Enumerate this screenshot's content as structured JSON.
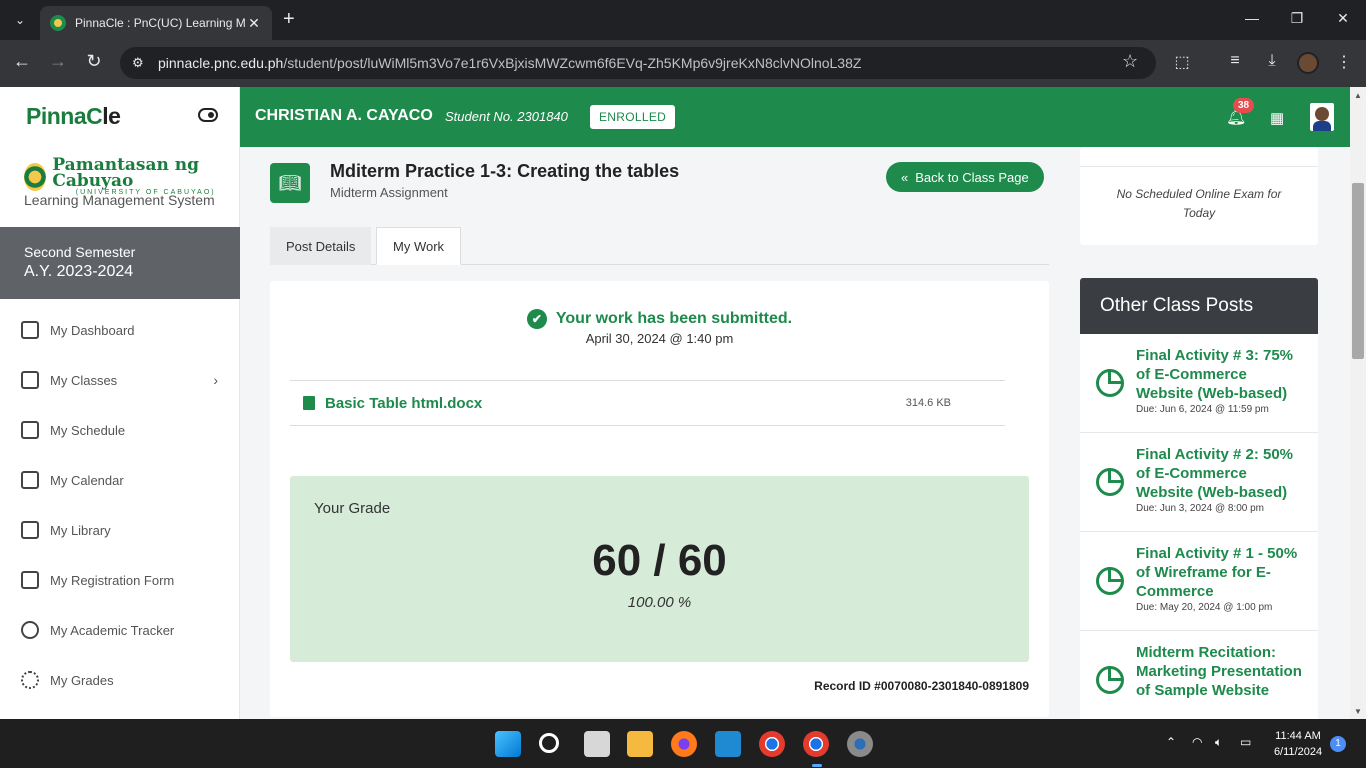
{
  "browser": {
    "tab_title": "PinnaCle : PnC(UC) Learning Ma",
    "url_host": "pinnacle.pnc.edu.ph",
    "url_path": "/student/post/luWiMl5m3Vo7e1r6VxBjxisMWZcwm6f6EVq-Zh5KMp6v9jreKxN8clvNOlnoL38Z"
  },
  "sidebar": {
    "logo_pin": "PinnaC",
    "logo_le": "le",
    "university_name": "Pamantasan ng Cabuyao",
    "university_sub": "(UNIVERSITY OF CABUYAO)",
    "system": "Learning Management System",
    "semester": "Second Semester",
    "academic_year": "A.Y. 2023-2024",
    "items": [
      {
        "label": "My Dashboard"
      },
      {
        "label": "My Classes"
      },
      {
        "label": "My Schedule"
      },
      {
        "label": "My Calendar"
      },
      {
        "label": "My Library"
      },
      {
        "label": "My Registration Form"
      },
      {
        "label": "My Academic Tracker"
      },
      {
        "label": "My Grades"
      }
    ]
  },
  "header": {
    "student_name": "CHRISTIAN A. CAYACO",
    "student_no": "Student No. 2301840",
    "status": "ENROLLED",
    "notifications": "38"
  },
  "post": {
    "title": "Mditerm Practice 1-3: Creating the tables",
    "subtitle": "Midterm Assignment",
    "back_label": "Back to Class Page",
    "tabs": [
      {
        "label": "Post Details"
      },
      {
        "label": "My Work"
      }
    ],
    "submitted_text": "Your work has been submitted.",
    "submitted_date": "April 30, 2024 @ 1:40 pm",
    "file_name": "Basic Table html.docx",
    "file_size": "314.6 KB",
    "grade_label": "Your Grade",
    "grade_score": "60 / 60",
    "grade_percent": "100.00 %",
    "record_id": "Record ID #0070080-2301840-0891809"
  },
  "exam": {
    "text": "No Scheduled Online Exam for Today"
  },
  "other_posts": {
    "title": "Other Class Posts",
    "items": [
      {
        "title": "Final Activity # 3: 75% of E-Commerce Website (Web-based)",
        "due": "Due: Jun 6, 2024 @ 11:59 pm"
      },
      {
        "title": "Final Activity # 2: 50% of E-Commerce Website (Web-based)",
        "due": "Due: Jun 3, 2024 @ 8:00 pm"
      },
      {
        "title": "Final Activity # 1 - 50% of Wireframe for E-Commerce",
        "due": "Due: May 20, 2024 @ 1:00 pm"
      },
      {
        "title": "Midterm Recitation: Marketing Presentation of Sample Website",
        "due": ""
      }
    ]
  },
  "taskbar": {
    "time": "11:44 AM",
    "date": "6/11/2024",
    "notification_count": "1"
  },
  "colors": {
    "brand_green": "#1e8a4c",
    "grade_bg": "#d6ecd9",
    "panel_dark": "#3a3d42"
  }
}
